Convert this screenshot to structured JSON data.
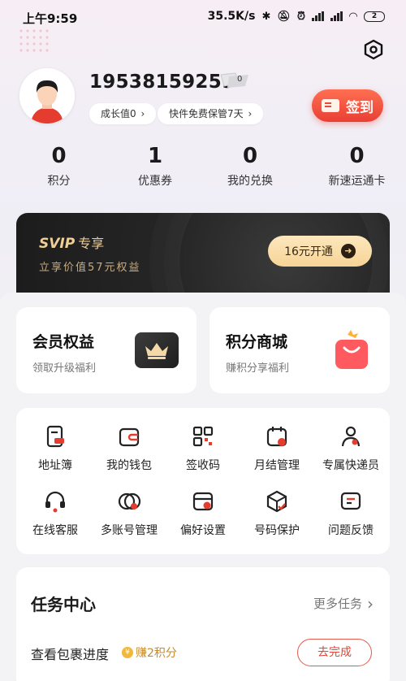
{
  "status_bar": {
    "time": "上午9:59",
    "net_speed": "35.5K/s",
    "battery": "2"
  },
  "profile": {
    "phone": "19538159259",
    "level_badge": "0",
    "growth_pill": "成长值0",
    "storage_pill": "快件免费保管7天",
    "signin_label": "签到"
  },
  "stats": [
    {
      "value": "0",
      "label": "积分"
    },
    {
      "value": "1",
      "label": "优惠券"
    },
    {
      "value": "0",
      "label": "我的兑换"
    },
    {
      "value": "0",
      "label": "新速运通卡"
    }
  ],
  "svip": {
    "title": "SVIP",
    "title_suffix": "专享",
    "subtitle": "立享价值57元权益",
    "button_label": "16元开通"
  },
  "benefits": {
    "vip": {
      "title": "会员权益",
      "subtitle": "领取升级福利"
    },
    "shop": {
      "title": "积分商城",
      "subtitle": "赚积分享福利"
    }
  },
  "services": [
    {
      "label": "地址簿",
      "icon": "address-book-icon"
    },
    {
      "label": "我的钱包",
      "icon": "wallet-icon"
    },
    {
      "label": "签收码",
      "icon": "qr-code-icon"
    },
    {
      "label": "月结管理",
      "icon": "calendar-icon"
    },
    {
      "label": "专属快递员",
      "icon": "courier-icon"
    },
    {
      "label": "在线客服",
      "icon": "headset-icon"
    },
    {
      "label": "多账号管理",
      "icon": "accounts-icon"
    },
    {
      "label": "偏好设置",
      "icon": "preferences-icon"
    },
    {
      "label": "号码保护",
      "icon": "shield-box-icon"
    },
    {
      "label": "问题反馈",
      "icon": "feedback-icon"
    }
  ],
  "tasks": {
    "title": "任务中心",
    "more_label": "更多任务",
    "items": [
      {
        "name": "查看包裹进度",
        "reward": "赚2积分",
        "button": "去完成"
      }
    ]
  },
  "colors": {
    "accent_red": "#e93f33",
    "svip_gold": "#f0cf95",
    "svip_dark": "#1c1c1c"
  }
}
